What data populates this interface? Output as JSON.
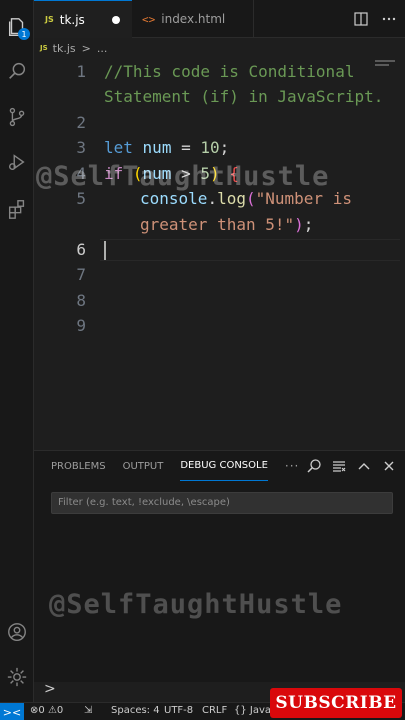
{
  "activity_bar": {
    "explorer_badge": "1",
    "icons": [
      "files-icon",
      "search-icon",
      "source-control-icon",
      "run-debug-icon",
      "extensions-icon",
      "account-icon",
      "settings-gear-icon"
    ]
  },
  "tabs": [
    {
      "icon": "JS",
      "label": "tk.js",
      "active": true,
      "modified": true
    },
    {
      "icon": "<>",
      "label": "index.html",
      "active": false
    }
  ],
  "breadcrumb": {
    "icon": "JS",
    "file": "tk.js",
    "separator": ">",
    "rest": "..."
  },
  "editor": {
    "line_numbers": [
      "1",
      "2",
      "3",
      "4",
      "5",
      "6",
      "7",
      "8",
      "9"
    ],
    "active_line": "6",
    "code": {
      "l1a": "//This code is Conditional",
      "l1b": "Statement (if) in JavaScript.",
      "l3_kw": "let",
      "l3_var": "num",
      "l3_op": " = ",
      "l3_num": "10",
      "l3_end": ";",
      "l4_if": "if",
      "l4_open": " (",
      "l4_var": "num",
      "l4_op": " > ",
      "l4_num": "5",
      "l4_close": ")",
      "l4_brace": " {",
      "l5_obj": "console",
      "l5_dot": ".",
      "l5_fn": "log",
      "l5_open": "(",
      "l5_str_a": "\"Number is",
      "l5_str_b": "greater than 5!\"",
      "l5_close": ")",
      "l5_semi": ";"
    },
    "watermark": "@SelfTaughtHustle"
  },
  "panel": {
    "tabs": [
      "PROBLEMS",
      "OUTPUT",
      "DEBUG CONSOLE",
      "···"
    ],
    "active_tab": "DEBUG CONSOLE",
    "filter_placeholder": "Filter (e.g. text, !exclude, \\escape)",
    "watermark": "@SelfTaughtHustle",
    "prompt": ">"
  },
  "statusbar": {
    "remote_icon": "><",
    "errors": "0",
    "warnings": "0",
    "spaces": "Spaces: 4",
    "encoding": "UTF-8",
    "eol": "CRLF",
    "language": "{} Java"
  },
  "overlay": {
    "subscribe": "SUBSCRIBE"
  },
  "colors": {
    "accent": "#0078d4",
    "subscribe_bg": "#d9080b",
    "comment": "#6a9955",
    "keyword": "#569cd6",
    "control": "#c586c0",
    "variable": "#9cdcfe",
    "number": "#b5cea8",
    "string": "#ce9178"
  }
}
